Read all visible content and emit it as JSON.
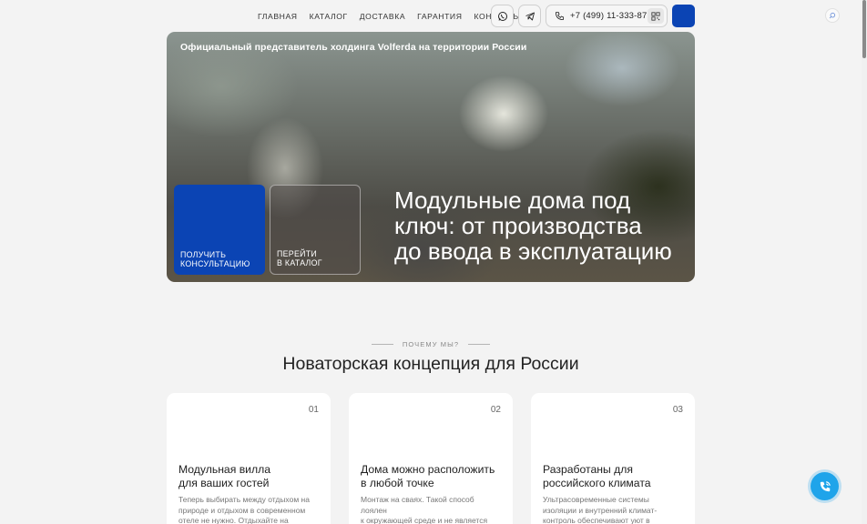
{
  "nav": [
    "ГЛАВНАЯ",
    "КАТАЛОГ",
    "ДОСТАВКА",
    "ГАРАНТИЯ",
    "КОНТАКТЫ"
  ],
  "header": {
    "whatsapp_icon": "whatsapp-icon",
    "telegram_icon": "telegram-icon",
    "phone": "+7 (499) 11-333-87",
    "phone_icon": "phone-icon",
    "qr_icon": "qr-code-icon",
    "accent": "#0b44b4"
  },
  "hero": {
    "tagline": "Официальный представитель холдинга Volferda на территории России",
    "consult_label": "ПОЛУЧИТЬ\nКОНСУЛЬТАЦИЮ",
    "catalog_label": "ПЕРЕЙТИ\nВ КАТАЛОГ",
    "title": "Модульные дома под\nключ: от производства\nдо ввода в эксплуатацию"
  },
  "section": {
    "eyebrow": "ПОЧЕМУ МЫ?",
    "title": "Новаторская концепция для России"
  },
  "features": [
    {
      "num": "01",
      "title": "Модульная вилла\nдля ваших гостей",
      "text": "Теперь выбирать между отдыхом на\nприроде и отдыхом в современном\nотеле не нужно. Отдыхайте на"
    },
    {
      "num": "02",
      "title": "Дома можно расположить\nв любой точке",
      "text": "Монтаж на сваях. Такой способ лоялен\nк окружающей среде и не является\nкапитальным строительством, а значит"
    },
    {
      "num": "03",
      "title": "Разработаны для\nроссийского климата",
      "text": "Ультрасовременные системы\nизоляции и внутренний климат-\nконтроль обеспечивают уют в"
    }
  ],
  "fab_color": "#1fa4ea"
}
